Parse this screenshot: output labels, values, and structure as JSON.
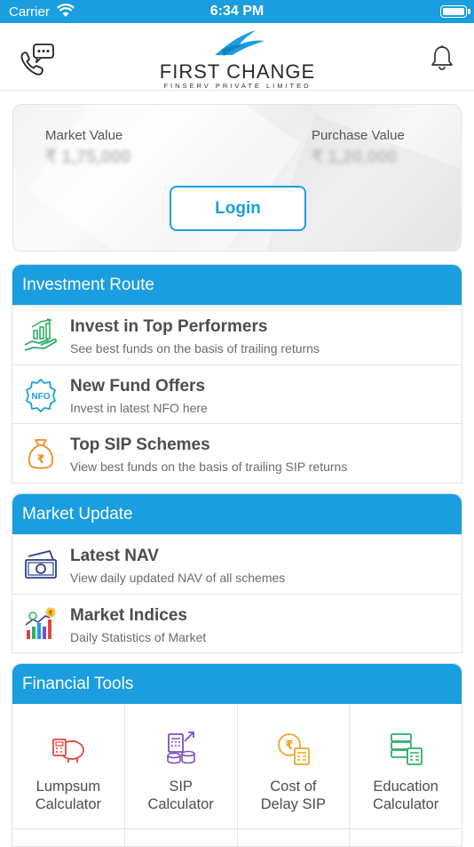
{
  "status_bar": {
    "carrier": "Carrier",
    "time": "6:34 PM"
  },
  "header": {
    "logo_text": "FIRST CHANGE",
    "logo_subtext": "FINSERV PRIVATE LIMITED"
  },
  "portfolio": {
    "market_value_label": "Market Value",
    "market_value": "₹ 1,75,000",
    "purchase_value_label": "Purchase Value",
    "purchase_value": "₹ 1,20,000",
    "login_label": "Login"
  },
  "investment_route": {
    "title": "Investment Route",
    "items": [
      {
        "title": "Invest in Top Performers",
        "desc": "See best funds on the basis of trailing returns",
        "icon": "money-growth-icon"
      },
      {
        "title": "New Fund Offers",
        "desc": "Invest in latest NFO here",
        "icon": "nfo-badge-icon"
      },
      {
        "title": "Top SIP Schemes",
        "desc": "View best funds on the basis of trailing SIP returns",
        "icon": "rupee-bag-icon"
      }
    ]
  },
  "market_update": {
    "title": "Market Update",
    "items": [
      {
        "title": "Latest NAV",
        "desc": "View daily updated NAV of all schemes",
        "icon": "banknote-icon"
      },
      {
        "title": "Market Indices",
        "desc": "Daily Statistics of Market",
        "icon": "market-chart-icon"
      }
    ]
  },
  "financial_tools": {
    "title": "Financial Tools",
    "items": [
      {
        "label": "Lumpsum\nCalculator",
        "icon": "piggy-calculator-icon"
      },
      {
        "label": "SIP\nCalculator",
        "icon": "coins-calculator-icon"
      },
      {
        "label": "Cost of\nDelay SIP",
        "icon": "rupee-calculator-icon"
      },
      {
        "label": "Education\nCalculator",
        "icon": "education-calculator-icon"
      }
    ]
  },
  "colors": {
    "accent": "#1a9ee0",
    "icon_green": "#2fae6a",
    "icon_orange": "#f08a24",
    "icon_red": "#e2463d",
    "icon_purple": "#7b4fc9"
  }
}
